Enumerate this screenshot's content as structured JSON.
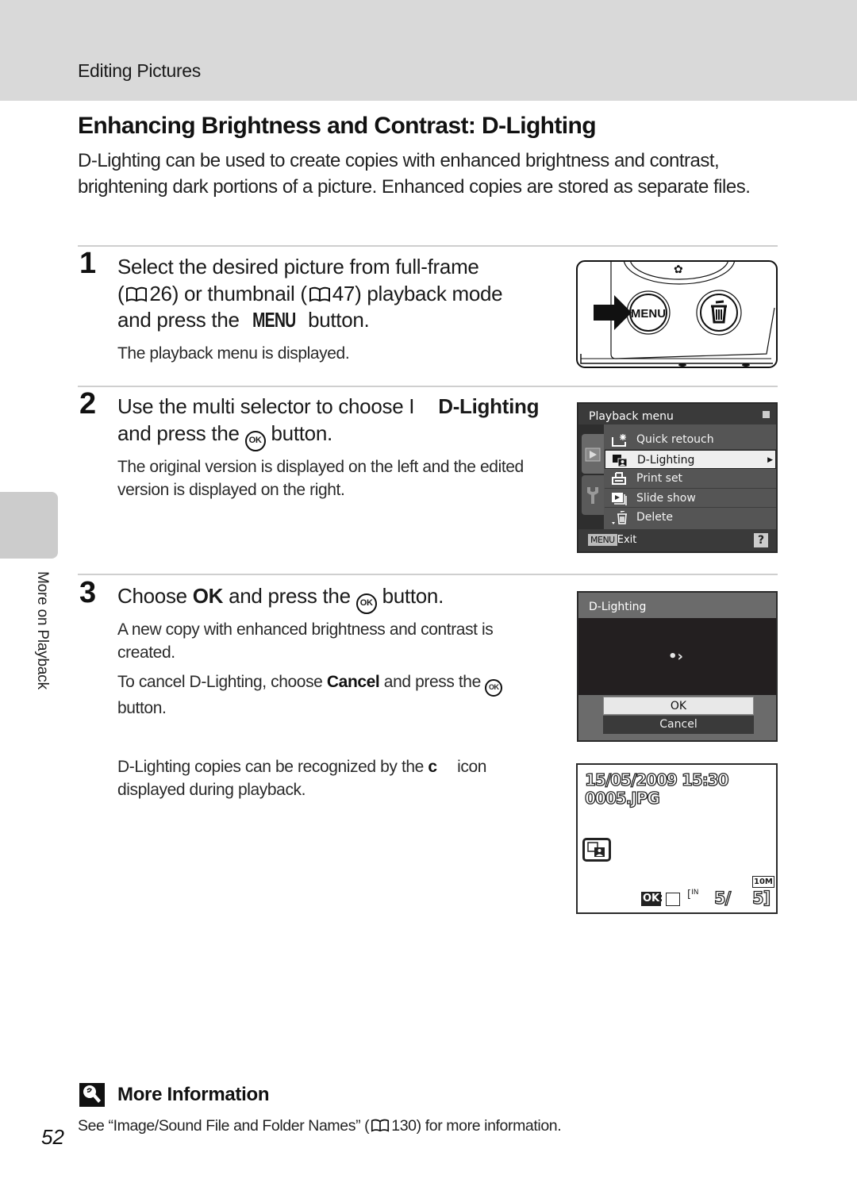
{
  "header": {
    "section": "Editing Pictures"
  },
  "title": "Enhancing Brightness and Contrast: D-Lighting",
  "intro": "D-Lighting can be used to create copies with enhanced brightness and contrast, brightening dark portions of a picture. Enhanced copies are stored as separate files.",
  "steps": [
    {
      "number": "1",
      "line1": "Select the desired picture from full-frame",
      "line2_a": "(",
      "line2_ref1": "26",
      "line2_b": ") or thumbnail (",
      "line2_ref2": "47",
      "line2_c": ") playback mode",
      "line3_a": "and press the ",
      "line3_key": "MENU",
      "line3_b": " button.",
      "note": "The playback menu is displayed."
    },
    {
      "number": "2",
      "line1_a": "Use the multi selector to choose ",
      "line1_glyph": "I",
      "line1_bold": "D-Lighting",
      "line2_a": "and press the ",
      "line2_key": "OK",
      "line2_b": " button.",
      "note": "The original version is displayed on the left and the edited version is displayed on the right."
    },
    {
      "number": "3",
      "line1_a": "Choose ",
      "line1_bold": "OK",
      "line1_b": " and press the ",
      "line1_key": "OK",
      "line1_c": " button.",
      "note1": "A new copy with enhanced brightness and contrast is created.",
      "note2_a": "To cancel D-Lighting, choose ",
      "note2_bold": "Cancel",
      "note2_b": " and press the ",
      "note2_key": "OK",
      "note2_c": " button.",
      "note3_a": "D-Lighting copies can be recognized by the ",
      "note3_glyph": "c",
      "note3_b": " icon displayed during playback."
    }
  ],
  "camera_illustration": {
    "menu_button_label": "MENU"
  },
  "playback_menu": {
    "title": "Playback menu",
    "items": [
      {
        "label": "Quick retouch",
        "icon": "quick-retouch-icon"
      },
      {
        "label": "D-Lighting",
        "icon": "d-lighting-icon",
        "selected": true
      },
      {
        "label": "Print set",
        "icon": "print-set-icon"
      },
      {
        "label": "Slide show",
        "icon": "slide-show-icon"
      },
      {
        "label": "Delete",
        "icon": "delete-icon"
      }
    ],
    "footer_key": "MENU",
    "footer_label": "Exit",
    "help": "?"
  },
  "dlighting_screen": {
    "title": "D-Lighting",
    "options": [
      "OK",
      "Cancel"
    ],
    "selected": "OK"
  },
  "playback_display": {
    "datetime": "15/05/2009 15:30",
    "filename": "0005.JPG",
    "image_size": "10M",
    "ok_badge": "OK",
    "memory": "IN",
    "frame": "5/",
    "total": "5"
  },
  "side_tab": {
    "label": "More on Playback"
  },
  "more_info": {
    "title": "More Information",
    "text_a": "See “Image/Sound File and Folder Names” (",
    "ref": "130",
    "text_b": ") for more information."
  },
  "page_number": "52"
}
